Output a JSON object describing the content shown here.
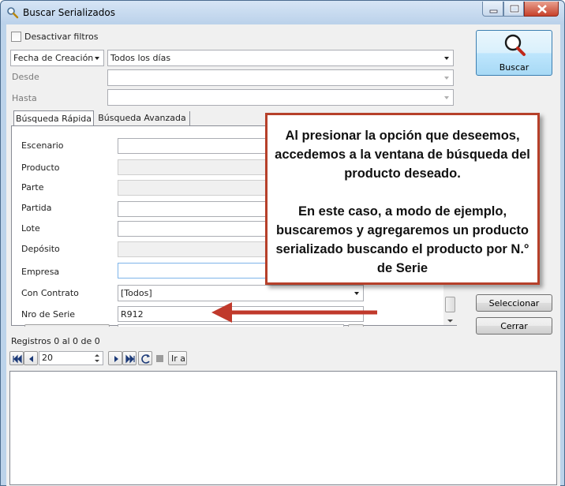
{
  "window": {
    "title": "Buscar Serializados"
  },
  "filters": {
    "disable_label": "Desactivar filtros",
    "date_field_value": "Fecha de Creación",
    "period_value": "Todos los días",
    "from_label": "Desde",
    "to_label": "Hasta"
  },
  "buttons": {
    "search": "Buscar",
    "select": "Seleccionar",
    "close": "Cerrar",
    "goto": "Ir a"
  },
  "tabs": [
    {
      "label": "Búsqueda Rápida"
    },
    {
      "label": "Búsqueda Avanzada"
    }
  ],
  "form": {
    "fields": [
      {
        "label": "Escenario",
        "value": ""
      },
      {
        "label": "Producto",
        "value": ""
      },
      {
        "label": "Parte",
        "value": ""
      },
      {
        "label": "Partida",
        "value": ""
      },
      {
        "label": "Lote",
        "value": ""
      },
      {
        "label": "Depósito",
        "value": ""
      },
      {
        "label": "Empresa",
        "value": ""
      },
      {
        "label": "Con Contrato",
        "value": "[Todos]"
      },
      {
        "label": "Nro de Serie",
        "value": "R912"
      }
    ]
  },
  "records": {
    "text": "Registros 0 al 0 de 0"
  },
  "pager": {
    "page_size": "20"
  },
  "callout": {
    "paragraph1": "Al presionar la opción que deseemos, accedemos a la ventana de búsqueda del producto deseado.",
    "paragraph2": "En este caso, a modo de ejemplo, buscaremos y agregaremos un producto serializado buscando el producto por N.° de Serie"
  },
  "colors": {
    "accent": "#b6402a",
    "titlebar": "#bad1ea",
    "button_active": "#3c7fb1"
  },
  "icons": [
    "search-icon",
    "minimize-icon",
    "maximize-icon",
    "close-icon",
    "first-page-icon",
    "previous-page-icon",
    "next-page-icon",
    "last-page-icon",
    "refresh-icon",
    "stop-icon",
    "arrow-icon"
  ]
}
